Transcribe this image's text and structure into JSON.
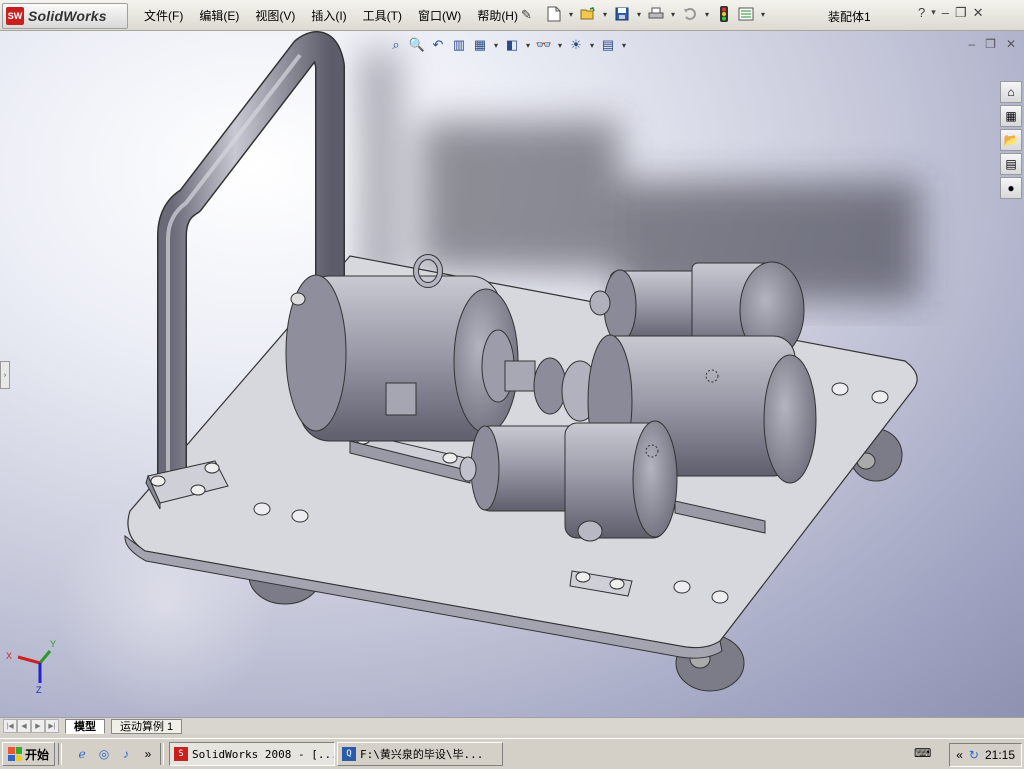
{
  "app": {
    "logo_text": "SolidWorks",
    "logo_badge": "SW",
    "document_title": "装配体1"
  },
  "menu": [
    "文件(F)",
    "编辑(E)",
    "视图(V)",
    "插入(I)",
    "工具(T)",
    "窗口(W)",
    "帮助(H)"
  ],
  "titlebar_controls": {
    "help": "?",
    "help_dropdown": "▾",
    "minimize": "–",
    "restore": "❐",
    "close": "✕"
  },
  "toolbar_standard": [
    "new-document-icon",
    "open-folder-icon",
    "save-icon",
    "print-icon",
    "undo-icon",
    "rebuild-traffic-light-icon",
    "options-icon"
  ],
  "toolbar_view": [
    "zoom-to-fit-icon",
    "zoom-to-area-icon",
    "previous-view-icon",
    "section-view-icon",
    "view-orientation-icon",
    "display-style-icon",
    "hide-show-items-icon",
    "apply-scene-icon",
    "view-settings-icon"
  ],
  "viewport_controls": {
    "minimize": "–",
    "restore": "❐",
    "close": "✕"
  },
  "task_pane": [
    "home-icon",
    "design-library-icon",
    "file-explorer-icon",
    "view-palette-icon",
    "appearances-icon"
  ],
  "triad": {
    "x": "X",
    "y": "Y",
    "z": "Z"
  },
  "bottom_tabs": {
    "model": "模型",
    "motion": "运动算例 1"
  },
  "taskbar": {
    "start": "开始",
    "chevron": "»",
    "tasks": [
      {
        "label": "SolidWorks 2008 - [...",
        "icon": "solidworks-icon",
        "active": true
      },
      {
        "label": "F:\\黄兴泉的毕设\\毕...",
        "icon": "folder-search-icon",
        "active": false
      }
    ],
    "tray_chevron": "«",
    "clock": "21:15"
  }
}
